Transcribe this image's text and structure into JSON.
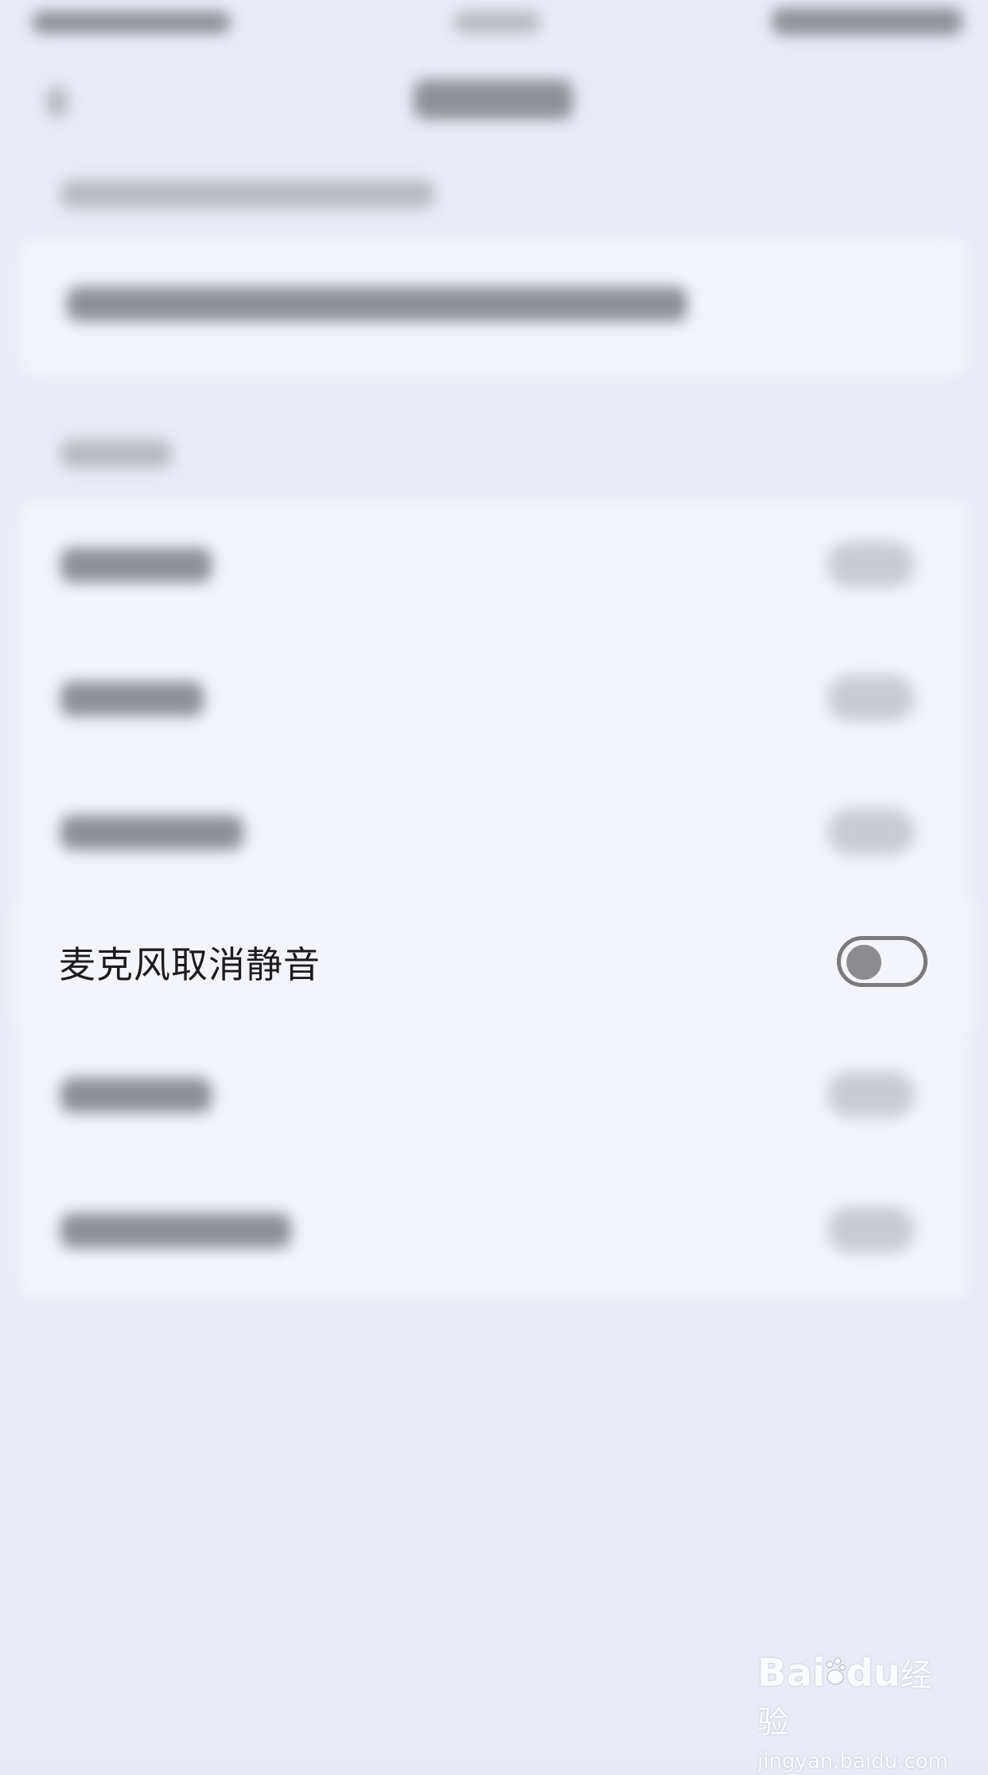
{
  "focused_setting": {
    "label": "麦克风取消静音",
    "toggle_on": false
  },
  "watermark": {
    "logo_text_left": "Bai",
    "logo_text_right": "du",
    "logo_suffix": "经验",
    "url": "jingyan.baidu.com"
  },
  "colors": {
    "background": "#e9ecf5",
    "row_background": "#f4f5fa",
    "label_text": "#1c1c1e",
    "toggle_border": "#7a7a7e",
    "toggle_knob": "#8c8c90"
  }
}
